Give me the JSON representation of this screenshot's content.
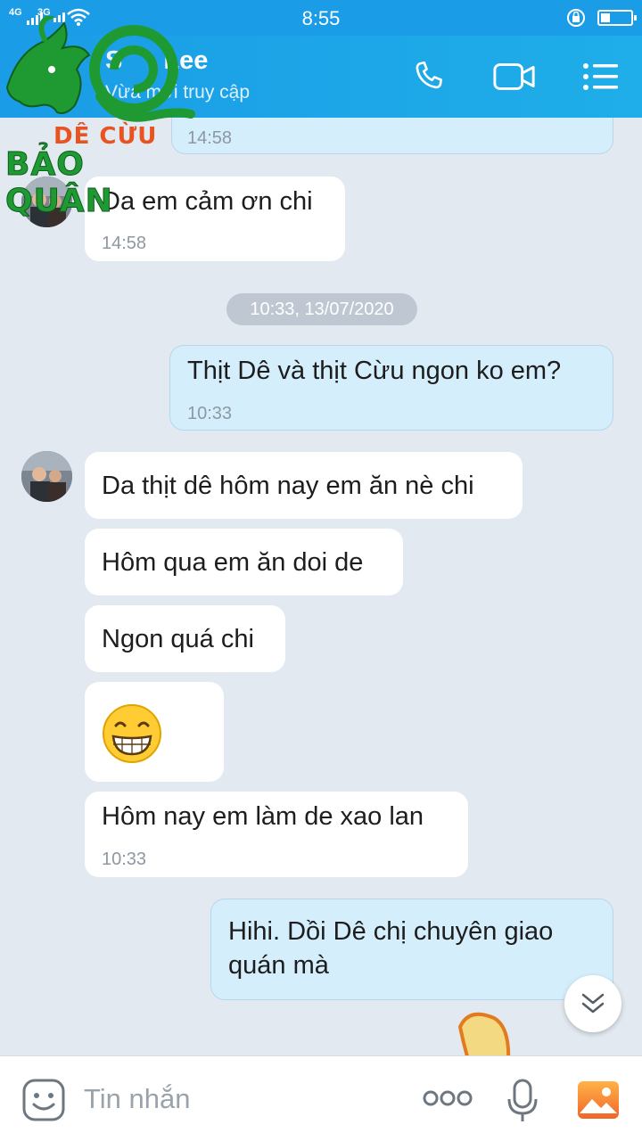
{
  "status_bar": {
    "time": "8:55",
    "network_1": "4G",
    "network_2": "3G"
  },
  "header": {
    "contact_name": "Lee",
    "contact_name_prefix_hidden": "S",
    "status": "Vừa mới truy cập",
    "icons": [
      "phone-icon",
      "video-call-icon",
      "menu-icon"
    ]
  },
  "logo": {
    "line1": "DÊ CỪU",
    "line2": "BẢO QUÂN"
  },
  "messages": [
    {
      "dir": "out",
      "text": "",
      "time": "14:58"
    },
    {
      "dir": "in",
      "text": "Da em cảm ơn chi",
      "time": "14:58"
    },
    {
      "dir": "out",
      "text": "Thịt Dê và thịt Cừu ngon ko em?",
      "time": "10:33"
    },
    {
      "dir": "in",
      "text": "Da thịt dê hôm nay em ăn nè chi",
      "time": ""
    },
    {
      "dir": "in",
      "text": "Hôm qua em ăn doi de",
      "time": ""
    },
    {
      "dir": "in",
      "text": "Ngon quá chi",
      "time": ""
    },
    {
      "dir": "in",
      "text": "",
      "time": "",
      "emoji": "grinning-face-emoji"
    },
    {
      "dir": "in",
      "text": "Hôm nay em làm de xao lan",
      "time": "10:33"
    },
    {
      "dir": "out",
      "text": "Hihi.  Dồi Dê chị chuyên giao",
      "text_line2": "quán mà",
      "time": ""
    }
  ],
  "date_separator": "10:33, 13/07/2020",
  "input_bar": {
    "placeholder": "Tin nhắn",
    "icons": [
      "emoji-icon",
      "more-icon",
      "microphone-icon",
      "gallery-icon"
    ]
  },
  "colors": {
    "header": "#1a9ce6",
    "background": "#e2e9f1",
    "bubble_in": "#ffffff",
    "bubble_out": "#d5eefc",
    "logo_orange": "#e8531f",
    "logo_green": "#1f9a33"
  }
}
